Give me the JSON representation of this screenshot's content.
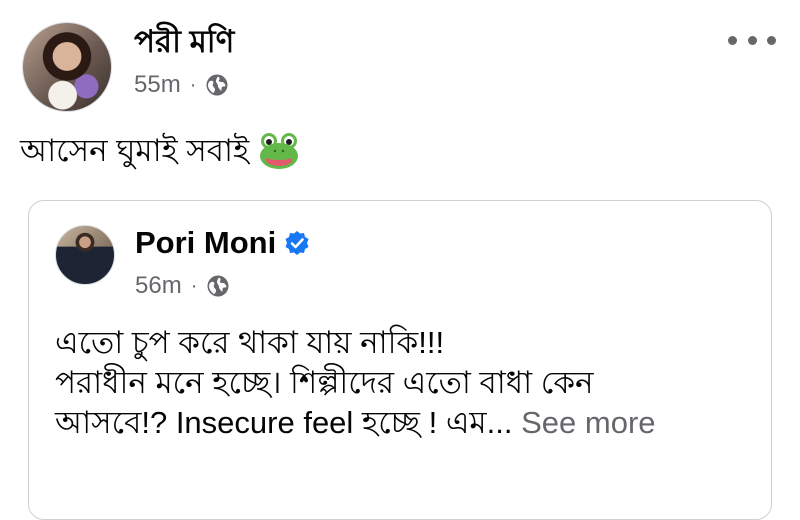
{
  "post": {
    "author": "পরী মণি",
    "time": "55m",
    "separator": "·",
    "text": "আসেন ঘুমাই সবাই",
    "emoji": "frog-face-emoji"
  },
  "shared_post": {
    "author": "Pori Moni",
    "verified": true,
    "time": "56m",
    "separator": "·",
    "lines": [
      "এতো চুপ করে থাকা যায় নাকি!!!",
      "পরাধীন মনে হচ্ছে। শিল্পীদের এতো বাধা কেন",
      "আসবে!? Insecure feel হচ্ছে ! এম..."
    ],
    "see_more": "See more"
  },
  "icons": {
    "privacy": "globe-icon",
    "verified": "verified-badge-icon",
    "menu": "more-options-icon"
  },
  "colors": {
    "secondary_text": "#65676b",
    "verified_blue": "#1877f2"
  }
}
